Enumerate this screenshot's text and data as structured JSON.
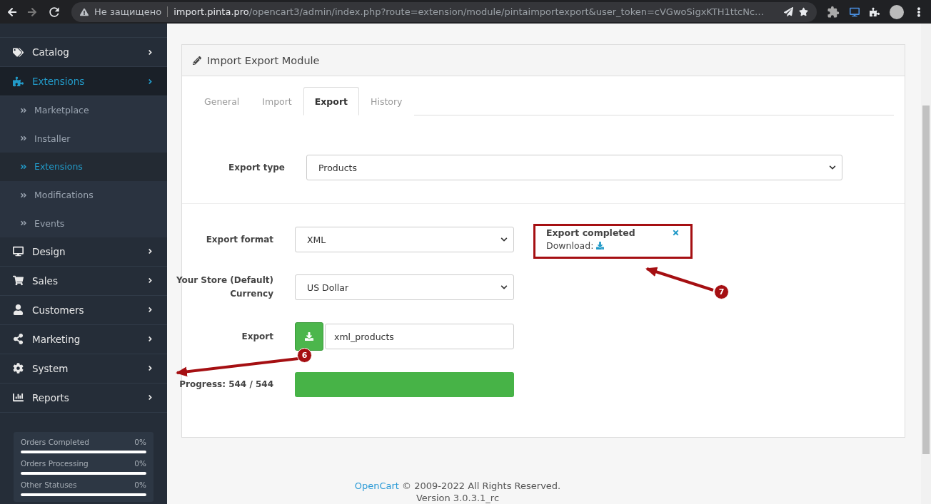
{
  "browser": {
    "security_label": "Не защищено",
    "url_host": "import.pinta.pro",
    "url_path": "/opencart3/admin/index.php?route=extension/module/pintaimportexport&user_token=cVGwoSigxKTH1ttcNc…"
  },
  "sidebar": {
    "items": [
      {
        "label": "Catalog",
        "selected": false
      },
      {
        "label": "Extensions",
        "selected": true,
        "children": [
          {
            "label": "Marketplace",
            "selected": false
          },
          {
            "label": "Installer",
            "selected": false
          },
          {
            "label": "Extensions",
            "selected": true
          },
          {
            "label": "Modifications",
            "selected": false
          },
          {
            "label": "Events",
            "selected": false
          }
        ]
      },
      {
        "label": "Design",
        "selected": false
      },
      {
        "label": "Sales",
        "selected": false
      },
      {
        "label": "Customers",
        "selected": false
      },
      {
        "label": "Marketing",
        "selected": false
      },
      {
        "label": "System",
        "selected": false
      },
      {
        "label": "Reports",
        "selected": false
      }
    ],
    "stats": [
      {
        "label": "Orders Completed",
        "value": "0%"
      },
      {
        "label": "Orders Processing",
        "value": "0%"
      },
      {
        "label": "Other Statuses",
        "value": "0%"
      }
    ]
  },
  "panel": {
    "title": "Import Export Module",
    "tabs": [
      {
        "label": "General",
        "selected": false
      },
      {
        "label": "Import",
        "selected": false
      },
      {
        "label": "Export",
        "selected": true
      },
      {
        "label": "History",
        "selected": false
      }
    ],
    "export_type": {
      "label": "Export type",
      "value": "Products"
    },
    "rows": [
      {
        "kind": "select",
        "label": "Export format",
        "value": "XML"
      },
      {
        "kind": "select",
        "label": "Your Store (Default) Currency",
        "value": "US Dollar"
      },
      {
        "kind": "export",
        "label": "Export",
        "value": "xml_products"
      },
      {
        "kind": "progress",
        "label": "Progress: 544 / 544",
        "level": 1
      }
    ],
    "alert": {
      "title": "Export completed",
      "download_label": "Download:"
    }
  },
  "annotations": [
    {
      "number": "6"
    },
    {
      "number": "7"
    }
  ],
  "footer": {
    "link": "OpenCart",
    "copyright": "© 2009-2022 All Rights Reserved.",
    "version": "Version 3.0.3.1_rc"
  }
}
